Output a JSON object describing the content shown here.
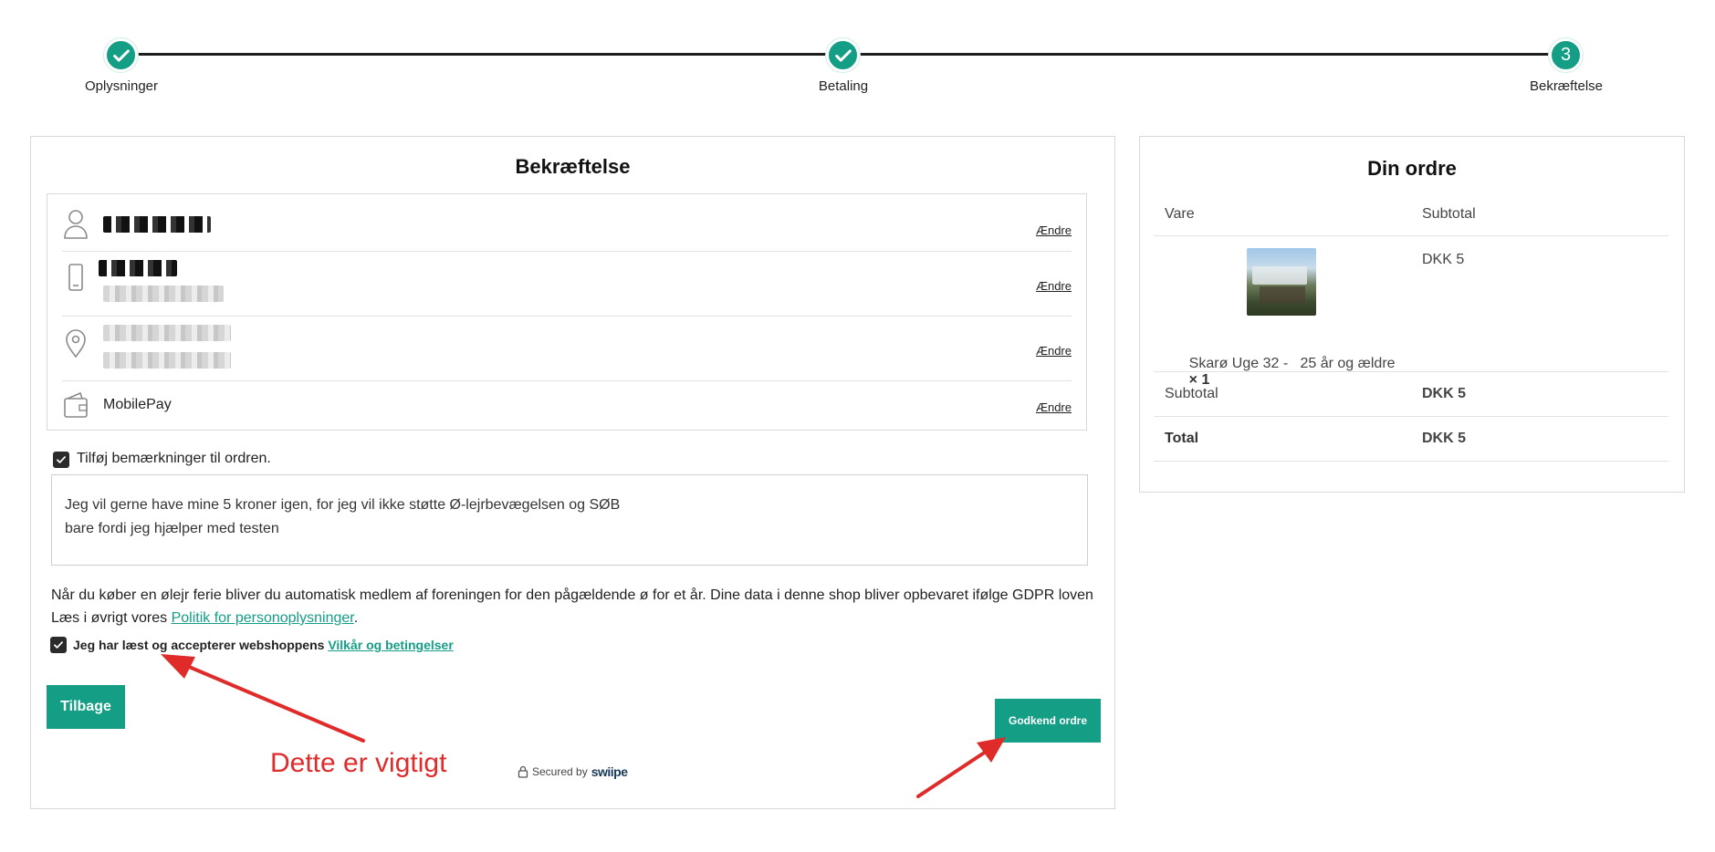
{
  "stepper": {
    "steps": [
      {
        "label": "Oplysninger",
        "status": "done"
      },
      {
        "label": "Betaling",
        "status": "done"
      },
      {
        "label": "Bekræftelse",
        "status": "current",
        "number": "3"
      }
    ]
  },
  "confirmation": {
    "title": "Bekræftelse",
    "rows": [
      {
        "icon": "user-icon",
        "change": "Ændre"
      },
      {
        "icon": "phone-icon",
        "change": "Ændre"
      },
      {
        "icon": "location-pin-icon",
        "change": "Ændre"
      },
      {
        "icon": "wallet-icon",
        "text": "MobilePay",
        "change": "Ændre"
      }
    ],
    "notes_checkbox_label": "Tilføj bemærkninger til ordren.",
    "notes_text": "Jeg vil gerne have mine 5 kroner igen, for jeg vil ikke støtte Ø-lejrbevægelsen og SØB\nbare fordi jeg hjælper med testen",
    "gdpr_line1": "Når du køber en ølejr ferie bliver du automatisk medlem af foreningen for den pågældende ø for et år. Dine data i denne shop bliver opbevaret ifølge GDPR loven",
    "gdpr_line2_prefix": "Læs i øvrigt vores ",
    "gdpr_link": "Politik for personoplysninger",
    "gdpr_line2_suffix": ".",
    "terms_label": "Jeg har læst og accepterer webshoppens ",
    "terms_link": "Vilkår og betingelser",
    "back_button": "Tilbage",
    "approve_button": "Godkend ordre",
    "secured_prefix": "Secured by",
    "secured_brand": "swiipe"
  },
  "order": {
    "title": "Din ordre",
    "col_item": "Vare",
    "col_subtotal": "Subtotal",
    "item_price": "DKK 5",
    "item_name": "Skarø Uge 32 -   25 år og ældre",
    "item_qty": "× 1",
    "subtotal_label": "Subtotal",
    "subtotal_value": "DKK 5",
    "total_label": "Total",
    "total_value": "DKK 5"
  },
  "annotation": {
    "text": "Dette er vigtigt",
    "color": "#e02b2b"
  },
  "colors": {
    "accent": "#149e85",
    "annotation_red": "#e02b2b"
  }
}
